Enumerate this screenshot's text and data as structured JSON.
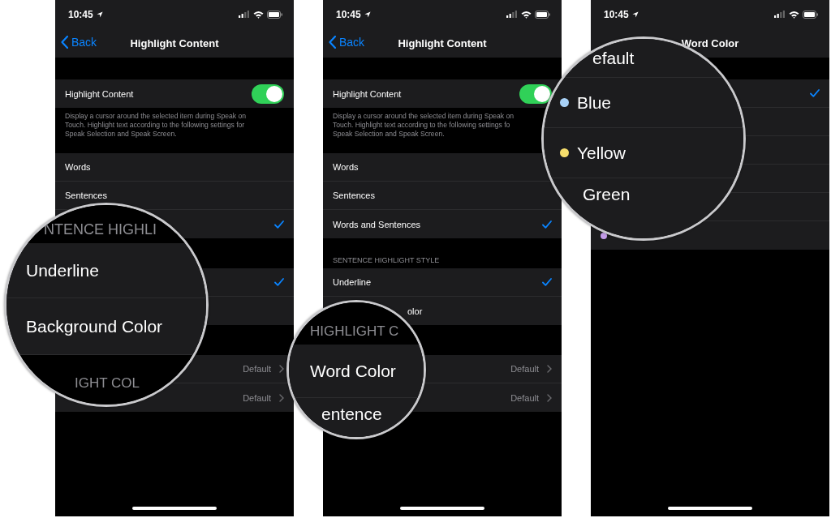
{
  "screens": [
    {
      "status": {
        "time": "10:45"
      },
      "nav": {
        "back": "Back",
        "title": "Highlight Content"
      },
      "toggle_row": {
        "label": "Highlight Content",
        "on": true
      },
      "description": {
        "lines": [
          "Display a cursor around the selected item during Speak on",
          "Touch. Highlight text according to the following settings for",
          "Speak Selection and Speak Screen."
        ]
      },
      "groups": [
        {
          "rows": [
            {
              "kind": "choice",
              "label": "Words",
              "selected": false
            },
            {
              "kind": "choice",
              "label": "Sentences",
              "selected": false
            },
            {
              "kind": "choice",
              "selected": true
            }
          ]
        },
        {
          "rows": [
            {
              "kind": "choice",
              "selected": true
            },
            {
              "kind": "choice",
              "selected": false
            }
          ]
        },
        {
          "rows": [
            {
              "kind": "link",
              "value": "Default"
            },
            {
              "kind": "link",
              "value": "Default"
            }
          ]
        }
      ]
    },
    {
      "status": {
        "time": "10:45"
      },
      "nav": {
        "back": "Back",
        "title": "Highlight Content"
      },
      "toggle_row": {
        "label": "Highlight Content",
        "on": true
      },
      "description": {
        "lines": [
          "Display a cursor around the selected item during Speak on",
          "Touch. Highlight text according to the following settings fo",
          "Speak Selection and Speak Screen."
        ]
      },
      "groups": [
        {
          "rows": [
            {
              "kind": "choice",
              "label": "Words",
              "selected": false
            },
            {
              "kind": "choice",
              "label": "Sentences",
              "selected": false
            },
            {
              "kind": "choice",
              "label": "Words and Sentences",
              "selected": true
            }
          ]
        },
        {
          "header": "SENTENCE HIGHLIGHT STYLE",
          "rows": [
            {
              "kind": "choice",
              "label": "Underline",
              "selected": true
            },
            {
              "kind": "choice",
              "label": "olor",
              "cut_start": true,
              "selected": false
            }
          ]
        },
        {
          "rows": [
            {
              "kind": "link",
              "value": "Default"
            },
            {
              "kind": "link",
              "value": "Default"
            }
          ]
        }
      ]
    },
    {
      "status": {
        "time": "10:45"
      },
      "nav": {
        "title": "Word Color"
      },
      "groups": [
        {
          "rows": [
            {
              "kind": "choice",
              "selected": true
            },
            {
              "kind": "choice",
              "selected": false
            },
            {
              "kind": "choice",
              "selected": false
            },
            {
              "kind": "choice",
              "selected": false
            },
            {
              "kind": "choice",
              "selected": false
            },
            {
              "kind": "choice",
              "selected": false,
              "color": "#c39be8"
            }
          ]
        }
      ]
    }
  ],
  "magnifiers": [
    {
      "items": [
        {
          "kind": "header",
          "text": "NTENCE HIGHLI"
        },
        {
          "kind": "row",
          "text": "Underline"
        },
        {
          "kind": "row",
          "text": "Background Color"
        },
        {
          "kind": "header",
          "text": "IGHT COL"
        }
      ]
    },
    {
      "items": [
        {
          "kind": "header",
          "text": "HIGHLIGHT C"
        },
        {
          "kind": "row",
          "text": "Word Color"
        },
        {
          "kind": "row",
          "text": "entence"
        }
      ]
    },
    {
      "items": [
        {
          "kind": "row",
          "text": "efault"
        },
        {
          "kind": "row",
          "text": "Blue",
          "color": "#a9d2f7"
        },
        {
          "kind": "row",
          "text": "Yellow",
          "color": "#f6de6c"
        },
        {
          "kind": "row",
          "text": "Green"
        }
      ]
    }
  ]
}
